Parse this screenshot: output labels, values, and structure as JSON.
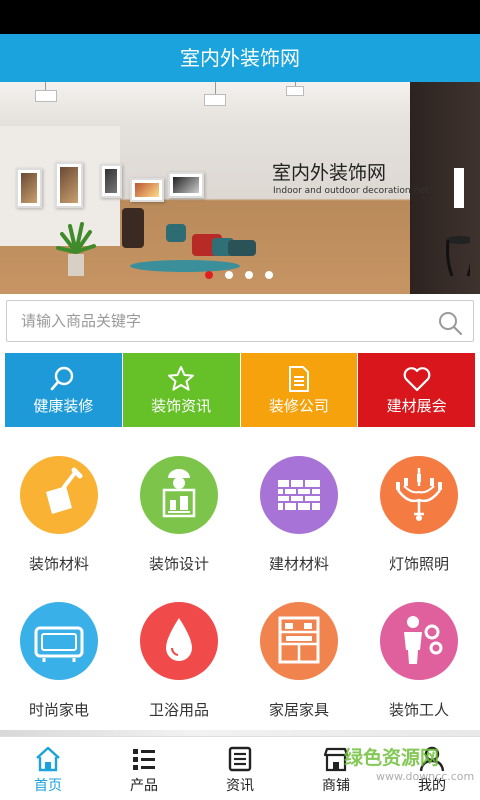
{
  "app": {
    "title": "室内外装饰网"
  },
  "banner": {
    "title": "室内外装饰网",
    "subtitle": "Indoor and outdoor decoration net",
    "slide_count": 4,
    "active_slide": 1
  },
  "search": {
    "placeholder": "请输入商品关键字",
    "value": ""
  },
  "quick_links": [
    {
      "label": "健康装修",
      "color": "#1e9ad9",
      "icon": "search-icon"
    },
    {
      "label": "装饰资讯",
      "color": "#66c028",
      "icon": "star-icon"
    },
    {
      "label": "装修公司",
      "color": "#f5a20c",
      "icon": "document-icon"
    },
    {
      "label": "建材展会",
      "color": "#d8161b",
      "icon": "heart-icon"
    }
  ],
  "categories": [
    {
      "label": "装饰材料",
      "color": "#f9b233",
      "icon": "trowel-icon"
    },
    {
      "label": "装饰设计",
      "color": "#7cc54a",
      "icon": "designer-icon"
    },
    {
      "label": "建材材料",
      "color": "#a873d6",
      "icon": "brick-wall-icon"
    },
    {
      "label": "灯饰照明",
      "color": "#f47b42",
      "icon": "chandelier-icon"
    },
    {
      "label": "时尚家电",
      "color": "#3ab0e8",
      "icon": "tv-icon"
    },
    {
      "label": "卫浴用品",
      "color": "#f04a4a",
      "icon": "water-drop-icon"
    },
    {
      "label": "家居家具",
      "color": "#f0834e",
      "icon": "cabinet-icon"
    },
    {
      "label": "装饰工人",
      "color": "#e0609e",
      "icon": "worker-icon"
    }
  ],
  "bottom_nav": [
    {
      "label": "首页",
      "icon": "home-icon",
      "active": true
    },
    {
      "label": "产品",
      "icon": "list-icon",
      "active": false
    },
    {
      "label": "资讯",
      "icon": "news-icon",
      "active": false
    },
    {
      "label": "商铺",
      "icon": "shop-icon",
      "active": false
    },
    {
      "label": "我的",
      "icon": "user-icon",
      "active": false
    }
  ],
  "watermark": {
    "text": "绿色资源网",
    "sub": "www.downcc.com"
  },
  "colors": {
    "accent": "#1aa3dd",
    "active_dot": "#e02020"
  }
}
